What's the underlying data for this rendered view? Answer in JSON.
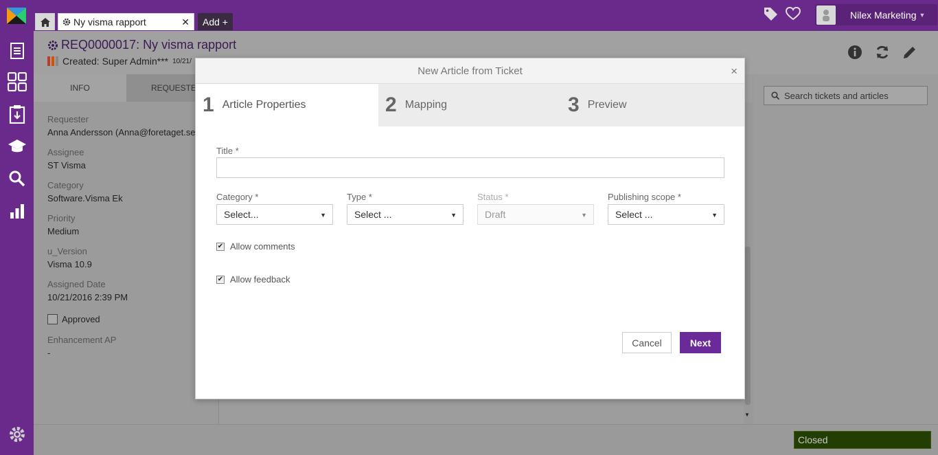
{
  "tabs": {
    "home_icon": "home-icon",
    "report_tab_label": "Ny visma rapport",
    "add_label": "Add +"
  },
  "user": {
    "name": "Nilex Marketing"
  },
  "page": {
    "title": "REQ0000017: Ny visma rapport",
    "created": "Created: Super Admin***",
    "created_date": "10/21/"
  },
  "panel_tabs": {
    "info": "INFO",
    "requester": "REQUESTER"
  },
  "fields": [
    {
      "label": "Requester",
      "value": "Anna Andersson (Anna@foretaget.se)"
    },
    {
      "label": "Assignee",
      "value": "ST Visma"
    },
    {
      "label": "Category",
      "value": "Software.Visma Ek"
    },
    {
      "label": "Priority",
      "value": "Medium"
    },
    {
      "label": "u_Version",
      "value": "Visma 10.9"
    },
    {
      "label": "Assigned Date",
      "value": "10/21/2016 2:39 PM"
    }
  ],
  "approved_label": "Approved",
  "enhancement": {
    "label": "Enhancement AP",
    "value": "-"
  },
  "search": {
    "placeholder": "Search tickets and articles"
  },
  "status": {
    "label": "Closed"
  },
  "modal": {
    "title": "New Article from Ticket",
    "close": "×",
    "steps": [
      {
        "num": "1",
        "label": "Article Properties"
      },
      {
        "num": "2",
        "label": "Mapping"
      },
      {
        "num": "3",
        "label": "Preview"
      }
    ],
    "title_label": "Title *",
    "title_value": "",
    "selects": [
      {
        "label": "Category *",
        "value": "Select..."
      },
      {
        "label": "Type *",
        "value": "Select ..."
      },
      {
        "label": "Status *",
        "value": "Draft"
      },
      {
        "label": "Publishing scope *",
        "value": "Select ..."
      }
    ],
    "allow_comments": "Allow comments",
    "allow_feedback": "Allow feedback",
    "cancel": "Cancel",
    "next": "Next"
  },
  "colors": {
    "brand": "#6a2a8c",
    "next_button": "#6a2a9a",
    "status_closed": "#233e02"
  }
}
